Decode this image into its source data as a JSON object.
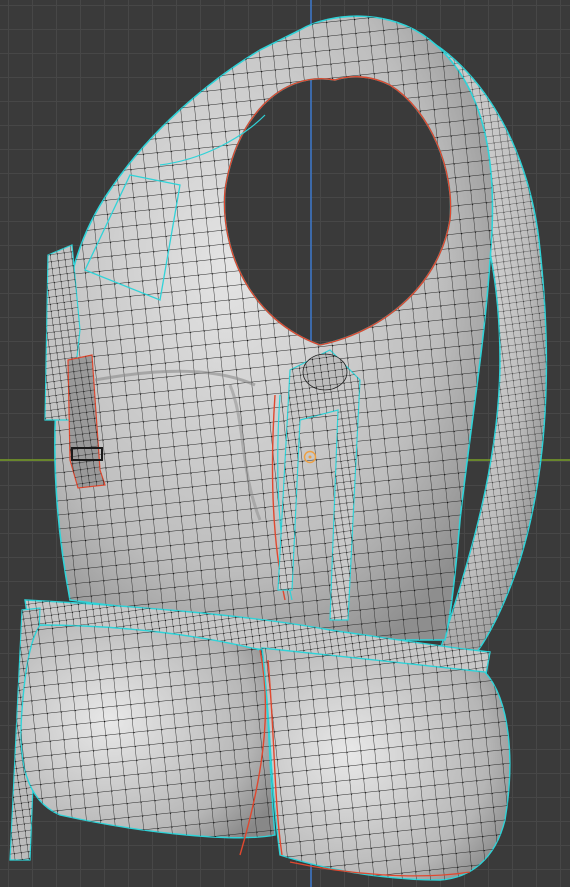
{
  "viewport": {
    "background_color": "#3a3a3a",
    "grid_color": "#474747",
    "axis_y_color": "#3d6fb6",
    "axis_x_color": "#6f8f2b"
  },
  "object": {
    "mode": "edit-mesh",
    "mesh_color": "#cfcfcf",
    "wire_color": "#1a1a1a",
    "seam_color": "#e0482f",
    "selected_edge_color": "#2fd3d8"
  },
  "origin_marker": {
    "icon": "origin-icon",
    "color": "#f0a040"
  }
}
